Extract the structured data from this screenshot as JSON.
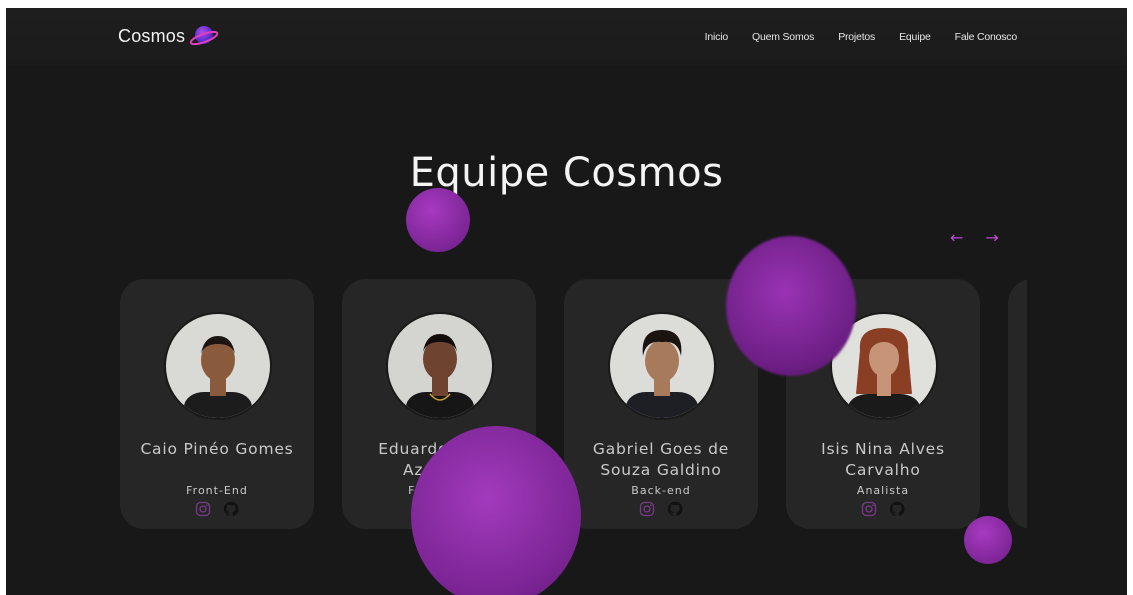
{
  "brand": {
    "name": "Cosmos",
    "logo_icon": "planet-icon"
  },
  "nav": {
    "links": [
      "Inicio",
      "Quem Somos",
      "Projetos",
      "Equipe",
      "Fale Conosco"
    ]
  },
  "section": {
    "title": "Equipe Cosmos"
  },
  "carousel": {
    "prev_icon": "←",
    "next_icon": "→"
  },
  "team": [
    {
      "name": "Caio Pinéo Gomes",
      "role": "Front-End",
      "skin": "#8a5a3c",
      "hair": "#1b1411",
      "shirt": "#1c1c1c"
    },
    {
      "name": "Eduardo Alves Azevedo",
      "role": "Front-End",
      "skin": "#6e4430",
      "hair": "#120d0b",
      "shirt": "#161616"
    },
    {
      "name": "Gabriel Goes de Souza Galdino",
      "role": "Back-end",
      "skin": "#a87a5c",
      "hair": "#1a1310",
      "shirt": "#1d1f24"
    },
    {
      "name": "Isis Nina Alves Carvalho",
      "role": "Analista",
      "skin": "#c79478",
      "hair": "#8a3f24",
      "shirt": "#1a1a1a"
    }
  ],
  "colors": {
    "accent": "#b94bd6",
    "bubble": "#7a2393",
    "card": "#262626",
    "background": "#181818"
  }
}
